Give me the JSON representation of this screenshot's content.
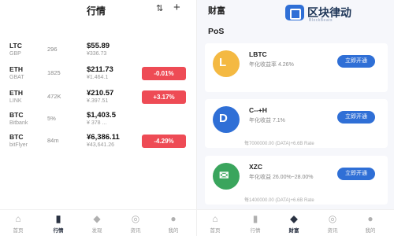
{
  "left": {
    "title": "行情",
    "markets": [
      {
        "symbol": "LTC",
        "sub": "GBP",
        "volume": "296",
        "price": "$55.89",
        "cny": "¥336.73",
        "change": "",
        "change_color": "#ffffff"
      },
      {
        "symbol": "ETH",
        "sub": "GBAT",
        "volume": "1825",
        "price": "$211.73",
        "cny": "¥1.464.1",
        "change": "-0.01%",
        "change_color": "#ee4b55"
      },
      {
        "symbol": "ETH",
        "sub": "LINK",
        "volume": "472K",
        "price": "¥210.57",
        "cny": "¥.397.51",
        "change": "+3.17%",
        "change_color": "#ee4b55"
      },
      {
        "symbol": "BTC",
        "sub": "Bitbank",
        "volume": "5%",
        "price": "$1,403.5",
        "cny": "¥ 378 ...",
        "change": "",
        "change_color": "#ffffff"
      },
      {
        "symbol": "BTC",
        "sub": "bitFlyer",
        "volume": "84m",
        "price": "¥6,386.11",
        "cny": "¥43,641.26",
        "change": "-4.29%",
        "change_color": "#ee4b55"
      }
    ],
    "tabs": [
      {
        "label": "首页",
        "icon": "⌂"
      },
      {
        "label": "行情",
        "icon": "▮"
      },
      {
        "label": "发现",
        "icon": "◆"
      },
      {
        "label": "资讯",
        "icon": "◎"
      },
      {
        "label": "我的",
        "icon": "●"
      }
    ]
  },
  "right": {
    "title": "财富",
    "brand_name": "区块律动",
    "brand_sub": "BlockBeats",
    "section": "PoS",
    "cards": [
      {
        "name": "LBTC",
        "rate": "年化收益率 4.26%",
        "meta": "",
        "button": "立即开通",
        "coin_glyph": "L",
        "coin_color": "#f4b942"
      },
      {
        "name": "C--+H",
        "rate": "年化收益 7.1%",
        "meta": "每7000000.00 (DATA)+6.6B Rate",
        "button": "立即开通",
        "coin_glyph": "D",
        "coin_color": "#2f6fd6"
      },
      {
        "name": "XZC",
        "rate": "年化收益 26.00%~28.00%",
        "meta": "每1400000.00 (DATA)+6.6B Rate",
        "button": "立即开通",
        "coin_glyph": "✉",
        "coin_color": "#3aa55d"
      }
    ],
    "tabs": [
      {
        "label": "首页",
        "icon": "⌂"
      },
      {
        "label": "行情",
        "icon": "▮"
      },
      {
        "label": "财富",
        "icon": "◆"
      },
      {
        "label": "资讯",
        "icon": "◎"
      },
      {
        "label": "我的",
        "icon": "●"
      }
    ]
  }
}
